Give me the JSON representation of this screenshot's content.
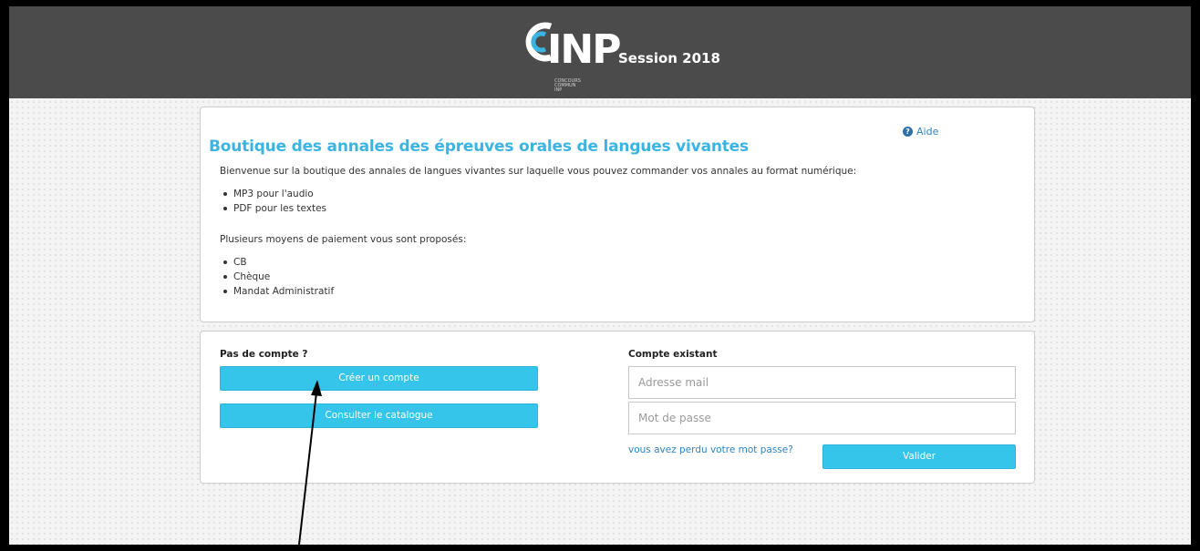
{
  "header": {
    "logo_text": "INP",
    "logo_subtext": "CONCOURS\nCOMMUN\nINP",
    "session_label": "Session 2018"
  },
  "info_panel": {
    "help_label": "Aide",
    "title": "Boutique des annales des épreuves orales de langues vivantes",
    "intro": "Bienvenue sur la boutique des annales de langues vivantes sur laquelle vous pouvez commander vos annales au format numérique:",
    "formats": [
      "MP3 pour l'audio",
      "PDF pour les textes"
    ],
    "payment_intro": "Plusieurs moyens de paiement vous sont proposés:",
    "payments": [
      "CB",
      "Chèque",
      "Mandat Administratif"
    ]
  },
  "account_panel": {
    "no_account_label": "Pas de compte ?",
    "create_button": "Créer un compte",
    "catalog_button": "Consulter le catalogue",
    "existing_label": "Compte existant",
    "email_placeholder": "Adresse mail",
    "password_placeholder": "Mot de passe",
    "lost_password_link": "vous avez perdu votre mot passe?",
    "validate_button": "Valider"
  },
  "colors": {
    "accent": "#35c4ea",
    "title": "#3ab4e0",
    "header_bg": "#4b4b4b",
    "link": "#2f84c4"
  }
}
